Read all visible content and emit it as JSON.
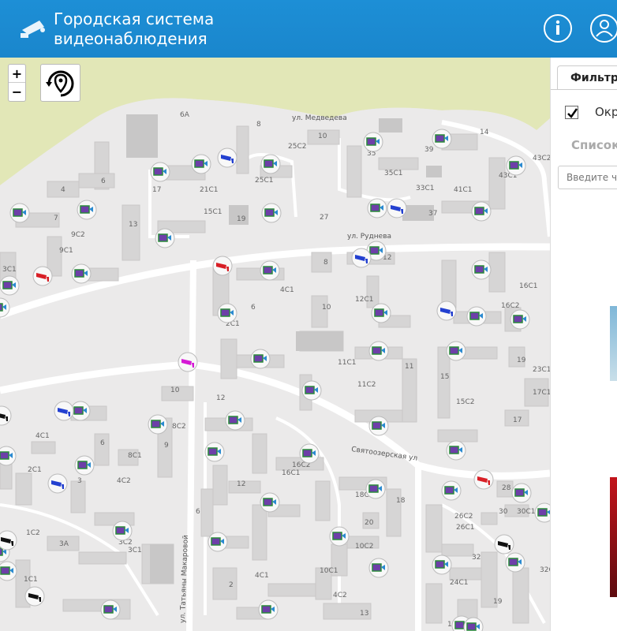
{
  "header": {
    "title_line1": "Городская система",
    "title_line2": "видеонаблюдения",
    "colors": {
      "header": "#1a8ad0"
    },
    "icons": [
      "camera-logo-icon",
      "info-icon",
      "user-icon"
    ]
  },
  "map": {
    "zoom_in": "+",
    "zoom_out": "−",
    "streets": {
      "medvedeva": "ул. Медведева",
      "rudneva": "ул. Руднева",
      "svyatoozerskaya": "Святоозерская ул",
      "makarovoy": "ул. Татьяны Макаровой"
    },
    "building_labels": [
      "6А",
      "8",
      "10",
      "14",
      "25С2",
      "35",
      "39",
      "43С2",
      "21С1",
      "25С1",
      "35С1",
      "33С1",
      "41С1",
      "43С1",
      "4",
      "6",
      "7",
      "17",
      "15С1",
      "13",
      "19",
      "27",
      "37",
      "9С2",
      "9С1",
      "3С1",
      "4С1",
      "8",
      "6",
      "12",
      "12С1",
      "10",
      "16С1",
      "16С2",
      "11С1",
      "11",
      "11С2",
      "15",
      "15С2",
      "19",
      "23С1",
      "17С1",
      "17",
      "12",
      "10",
      "8С2",
      "4С1",
      "6",
      "8С1",
      "9",
      "4С2",
      "2С1",
      "3",
      "3А",
      "3С2",
      "3С1",
      "1С2",
      "1С1",
      "12",
      "16С2",
      "16С1",
      "18С2",
      "18",
      "20",
      "10С2",
      "10С1",
      "4С1",
      "2",
      "4С2",
      "6",
      "13",
      "28",
      "30",
      "30С1",
      "26С2",
      "26С1",
      "32",
      "24С1",
      "32С1",
      "19",
      "17С1",
      "2С1"
    ],
    "markers": {
      "video_count": 52,
      "camera_blue": 6,
      "camera_red": 3,
      "camera_black": 4,
      "camera_magenta": 1
    }
  },
  "panel": {
    "tab_label": "Фильтр",
    "checkbox_label": "Окр",
    "checkbox_checked": true,
    "subheading": "Список",
    "search_placeholder": "Введите ч"
  }
}
